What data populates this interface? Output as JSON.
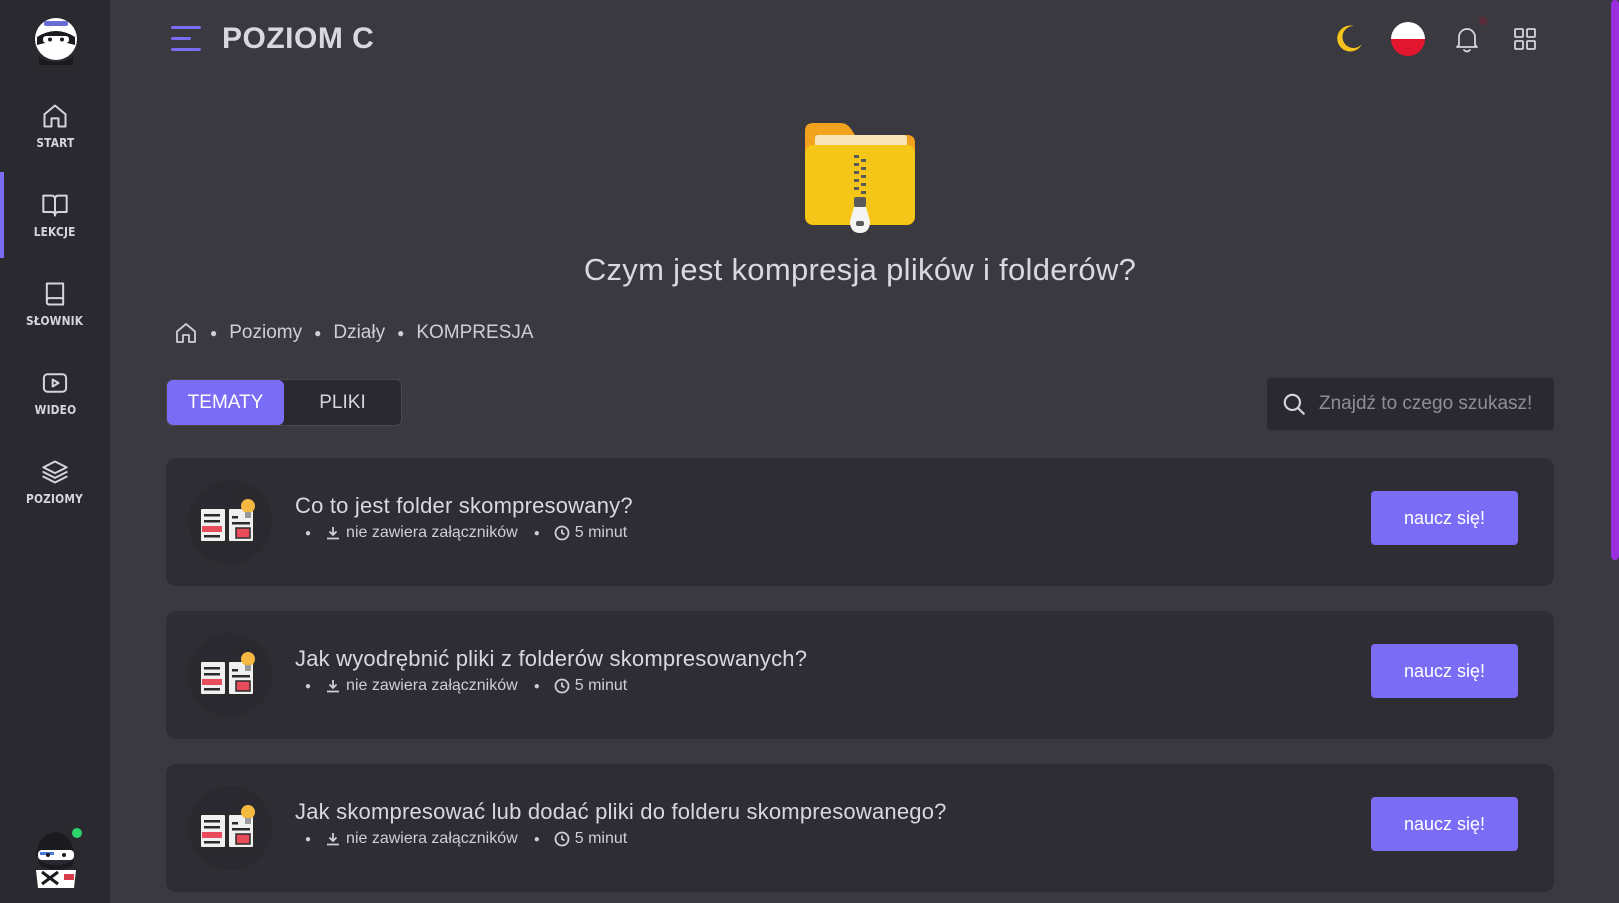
{
  "header": {
    "level_title": "POZIOM C"
  },
  "sidebar": {
    "items": [
      {
        "label": "START",
        "icon": "home-icon"
      },
      {
        "label": "LEKCJE",
        "icon": "book-open-icon",
        "active": true
      },
      {
        "label": "SŁOWNIK",
        "icon": "book-icon"
      },
      {
        "label": "WIDEO",
        "icon": "video-icon"
      },
      {
        "label": "POZIOMY",
        "icon": "layers-icon"
      }
    ]
  },
  "hero": {
    "title": "Czym jest kompresja plików i folderów?",
    "icon": "zip-folder-icon"
  },
  "breadcrumb": {
    "items": [
      "Poziomy",
      "Działy",
      "KOMPRESJA"
    ]
  },
  "tabs": [
    {
      "label": "TEMATY",
      "active": true
    },
    {
      "label": "PLIKI",
      "active": false
    }
  ],
  "search": {
    "placeholder": "Znajdź to czego szukasz!",
    "value": ""
  },
  "lessons": [
    {
      "title": "Co to jest folder skompresowany?",
      "attachments": "nie zawiera załączników",
      "duration": "5 minut",
      "button": "naucz się!"
    },
    {
      "title": "Jak wyodrębnić pliki z folderów skompresowanych?",
      "attachments": "nie zawiera załączników",
      "duration": "5 minut",
      "button": "naucz się!"
    },
    {
      "title": "Jak skompresować lub dodać pliki do folderu skompresowanego?",
      "attachments": "nie zawiera załączników",
      "duration": "5 minut",
      "button": "naucz się!"
    }
  ],
  "colors": {
    "accent": "#7b6cf5",
    "background": "#3a3940",
    "sidebar": "#2a292f",
    "card": "#2e2d33",
    "scrollbar": "#9b2fe0"
  }
}
